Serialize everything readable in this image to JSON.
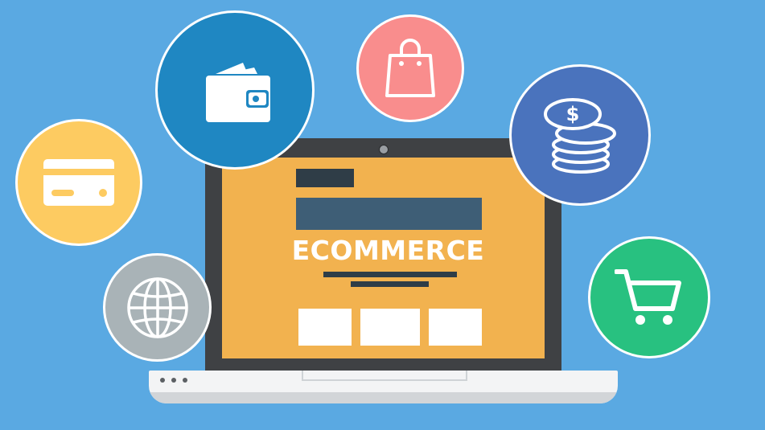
{
  "screen": {
    "headline": "ECOMMERCE"
  },
  "icons": [
    "wallet-icon",
    "shopping-bag-icon",
    "coins-icon",
    "credit-card-icon",
    "globe-icon",
    "shopping-cart-icon"
  ],
  "colors": {
    "background": "#5aa9e2",
    "screen": "#f2b24f",
    "wallet_circle": "#1f87c2",
    "bag_circle": "#f98d8d",
    "coins_circle": "#4a73bd",
    "card_circle": "#fdcb61",
    "globe_circle": "#a9b3b7",
    "cart_circle": "#28c180"
  }
}
